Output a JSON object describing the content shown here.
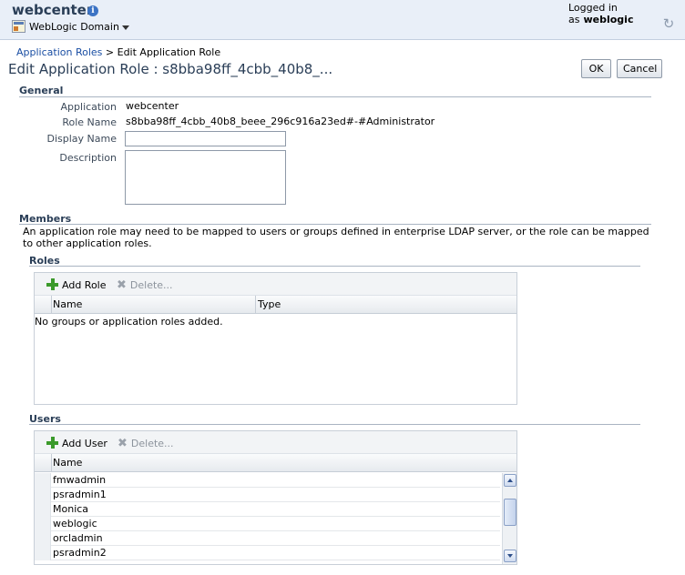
{
  "header": {
    "app_name": "webcenter",
    "info_icon": "info-icon",
    "domain_menu": "WebLogic Domain",
    "logged_in_label": "Logged in as",
    "user": "weblogic",
    "refresh_icon": "refresh-icon"
  },
  "breadcrumb": {
    "parent": "Application Roles",
    "separator": ">",
    "current": "Edit Application Role"
  },
  "page": {
    "title": "Edit Application Role : s8bba98ff_4cbb_40b8_...",
    "ok_label": "OK",
    "cancel_label": "Cancel"
  },
  "general": {
    "heading": "General",
    "application_label": "Application",
    "application_value": "webcenter",
    "role_name_label": "Role Name",
    "role_name_value": "s8bba98ff_4cbb_40b8_beee_296c916a23ed#-#Administrator",
    "display_name_label": "Display Name",
    "display_name_value": "",
    "description_label": "Description",
    "description_value": ""
  },
  "members": {
    "heading": "Members",
    "description": "An application role may need to be mapped to users or groups defined in enterprise LDAP server, or the role can be mapped to other application roles."
  },
  "roles": {
    "heading": "Roles",
    "add_label": "Add Role",
    "delete_label": "Delete...",
    "columns": [
      "Name",
      "Type"
    ],
    "empty_text": "No groups or application roles added."
  },
  "users": {
    "heading": "Users",
    "add_label": "Add User",
    "delete_label": "Delete...",
    "columns": [
      "Name"
    ],
    "rows": [
      "fmwadmin",
      "psradmin1",
      "Monica",
      "weblogic",
      "orcladmin",
      "psradmin2"
    ]
  },
  "colors": {
    "header_bg": "#e9eff8",
    "title_color": "#2a3e57",
    "link_color": "#1a4ea3",
    "add_icon_color": "#3b9a2b"
  }
}
